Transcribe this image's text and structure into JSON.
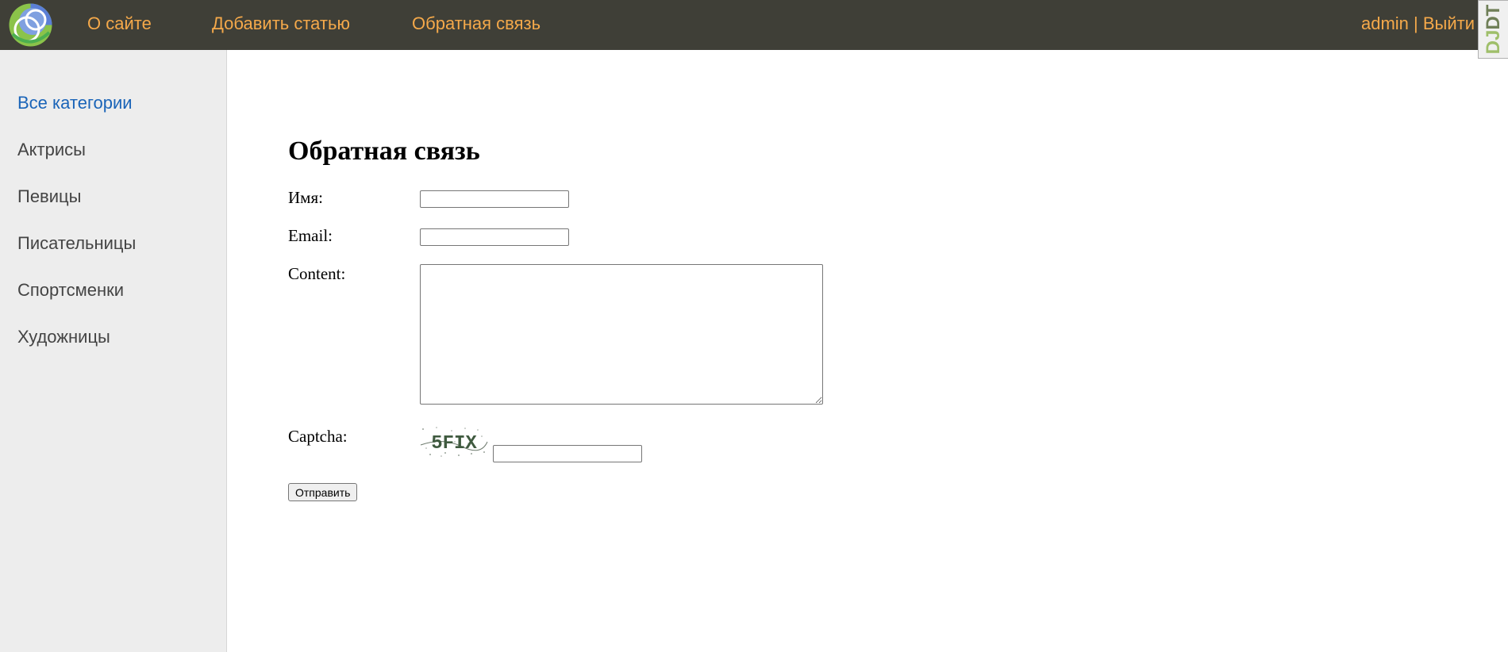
{
  "header": {
    "logo_icon": "site-logo-icon",
    "nav": [
      {
        "label": "О сайте"
      },
      {
        "label": "Добавить статью"
      },
      {
        "label": "Обратная связь"
      }
    ],
    "user": {
      "name": "admin",
      "separator": " | ",
      "logout": "Выйти"
    },
    "debug_toolbar": {
      "label": "DJDT"
    }
  },
  "sidebar": {
    "items": [
      {
        "label": "Все категории",
        "active": true
      },
      {
        "label": "Актрисы"
      },
      {
        "label": "Певицы"
      },
      {
        "label": "Писательницы"
      },
      {
        "label": "Спортсменки"
      },
      {
        "label": "Художницы"
      }
    ]
  },
  "form": {
    "title": "Обратная связь",
    "name_label": "Имя:",
    "name_value": "",
    "email_label": "Email:",
    "email_value": "",
    "content_label": "Content:",
    "content_value": "",
    "captcha_label": "Captcha:",
    "captcha_text": "5FIX",
    "captcha_value": "",
    "submit_label": "Отправить"
  },
  "colors": {
    "header_bg": "#3f3f37",
    "nav_link": "#f5a94a",
    "sidebar_bg": "#ededed",
    "sidebar_active": "#1a64b8",
    "sidebar_text": "#444444"
  }
}
